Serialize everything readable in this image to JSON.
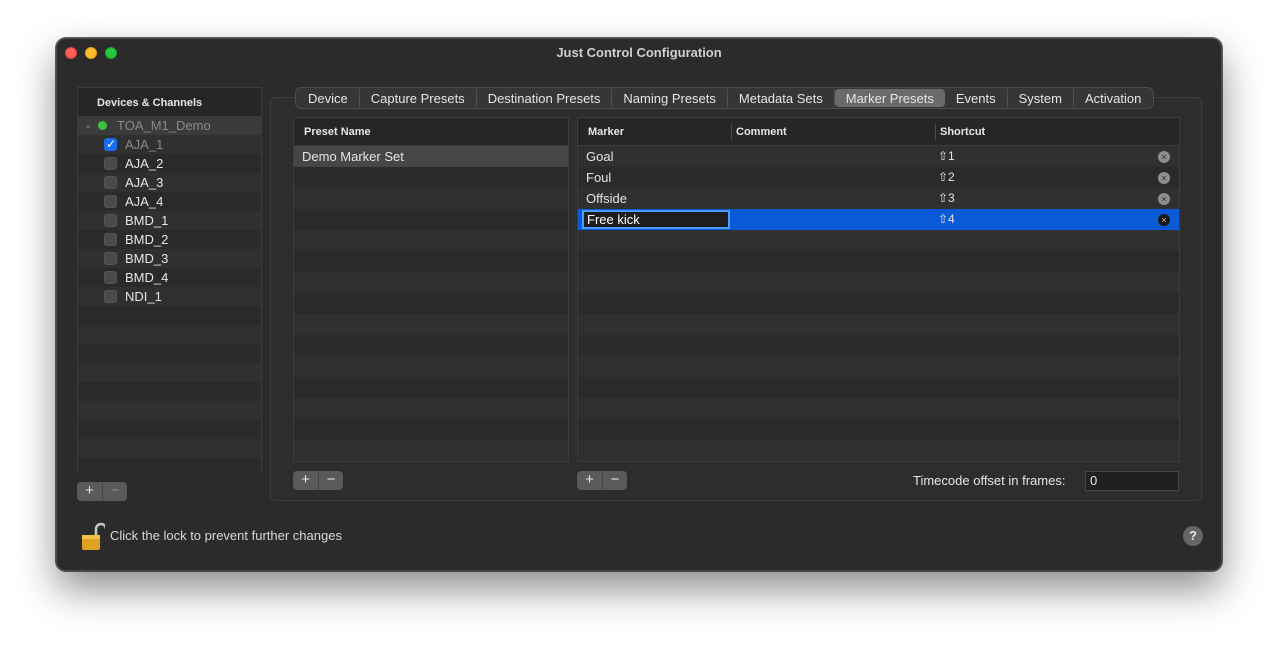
{
  "window": {
    "title": "Just Control Configuration"
  },
  "sidebar": {
    "header": "Devices & Channels",
    "root": {
      "label": "TOA_M1_Demo",
      "status_color": "#3fc041"
    },
    "channels": [
      {
        "label": "AJA_1",
        "checked": true
      },
      {
        "label": "AJA_2",
        "checked": false
      },
      {
        "label": "AJA_3",
        "checked": false
      },
      {
        "label": "AJA_4",
        "checked": false
      },
      {
        "label": "BMD_1",
        "checked": false
      },
      {
        "label": "BMD_2",
        "checked": false
      },
      {
        "label": "BMD_3",
        "checked": false
      },
      {
        "label": "BMD_4",
        "checked": false
      },
      {
        "label": "NDI_1",
        "checked": false
      }
    ],
    "add_label": "+",
    "remove_label": "−"
  },
  "tabs": [
    {
      "label": "Device"
    },
    {
      "label": "Capture Presets"
    },
    {
      "label": "Destination Presets"
    },
    {
      "label": "Naming Presets"
    },
    {
      "label": "Metadata Sets"
    },
    {
      "label": "Marker Presets",
      "active": true
    },
    {
      "label": "Events"
    },
    {
      "label": "System"
    },
    {
      "label": "Activation"
    }
  ],
  "presets": {
    "header": "Preset Name",
    "rows": [
      "Demo Marker Set"
    ],
    "add_label": "+",
    "remove_label": "−"
  },
  "markers": {
    "headers": {
      "marker": "Marker",
      "comment": "Comment",
      "shortcut": "Shortcut"
    },
    "rows": [
      {
        "marker": "Goal",
        "comment": "",
        "shortcut": "⇧1"
      },
      {
        "marker": "Foul",
        "comment": "",
        "shortcut": "⇧2"
      },
      {
        "marker": "Offside",
        "comment": "",
        "shortcut": "⇧3"
      },
      {
        "marker": "Free kick",
        "comment": "",
        "shortcut": "⇧4",
        "editing": true
      }
    ],
    "clear_icon": "clear-icon",
    "add_label": "+",
    "remove_label": "−"
  },
  "timecode": {
    "label": "Timecode offset in frames:",
    "value": "0"
  },
  "footer": {
    "lock_label": "Click the lock to prevent further changes",
    "help_label": "?"
  },
  "colors": {
    "accent": "#0a59d6",
    "status_green": "#3fc041",
    "lock": "#e0a020"
  }
}
